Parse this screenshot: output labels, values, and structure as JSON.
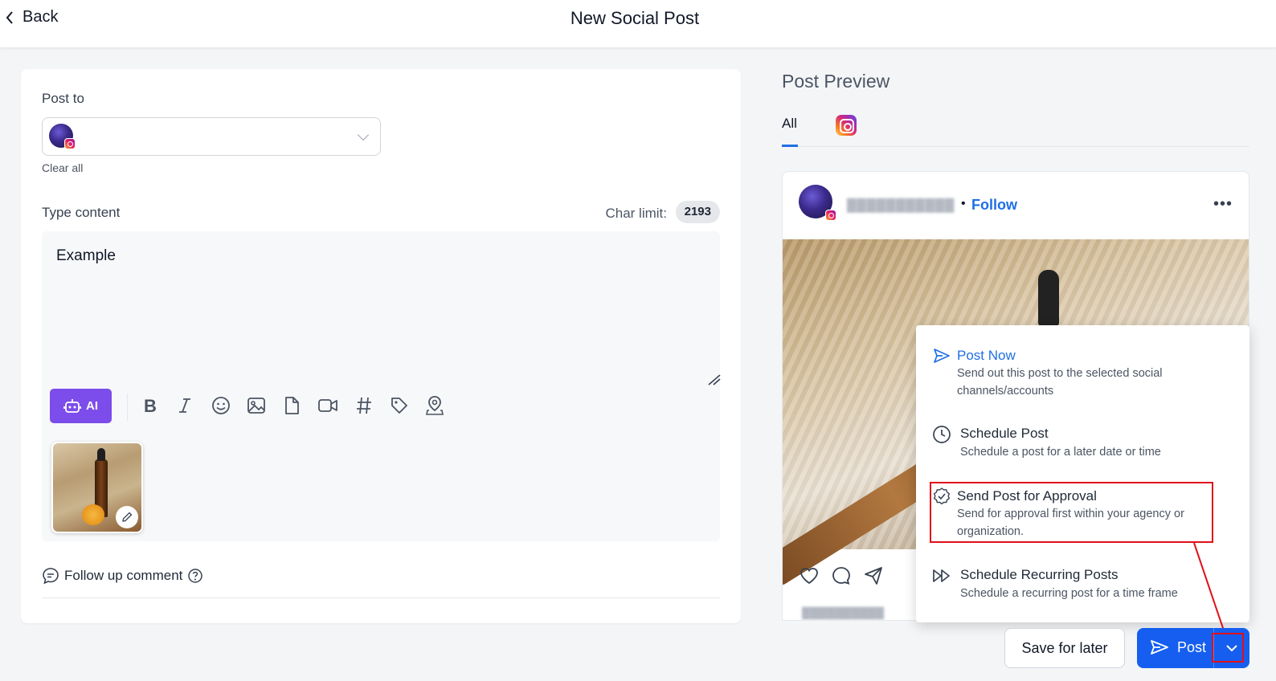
{
  "header": {
    "back_label": "Back",
    "title": "New Social Post"
  },
  "editor": {
    "post_to_label": "Post to",
    "clear_all": "Clear all",
    "type_content_label": "Type content",
    "char_limit_label": "Char limit:",
    "char_limit_value": "2193",
    "content_text": "Example",
    "ai_label": "AI",
    "toolbar_icons": [
      "bold-icon",
      "italic-icon",
      "emoji-icon",
      "image-icon",
      "file-icon",
      "video-icon",
      "hashtag-icon",
      "tag-icon",
      "location-icon"
    ],
    "follow_up_label": "Follow up comment"
  },
  "preview": {
    "title": "Post Preview",
    "tabs": [
      {
        "label": "All"
      }
    ],
    "follow_label": "Follow",
    "separator": "•",
    "more": "•••"
  },
  "menu": {
    "items": [
      {
        "title": "Post Now",
        "desc": "Send out this post to the selected social channels/accounts",
        "icon": "send-icon"
      },
      {
        "title": "Schedule Post",
        "desc": "Schedule a post for a later date or time",
        "icon": "clock-icon"
      },
      {
        "title": "Send Post for Approval",
        "desc": "Send for approval first within your agency or organization.",
        "icon": "approval-badge-icon"
      },
      {
        "title": "Schedule Recurring Posts",
        "desc": "Schedule a recurring post for a time frame",
        "icon": "fast-forward-icon"
      }
    ]
  },
  "footer": {
    "save_label": "Save for later",
    "post_label": "Post"
  },
  "colors": {
    "primary": "#155eef",
    "link": "#1f6fe5",
    "ai": "#7c4dea",
    "highlight": "#e0101a"
  }
}
